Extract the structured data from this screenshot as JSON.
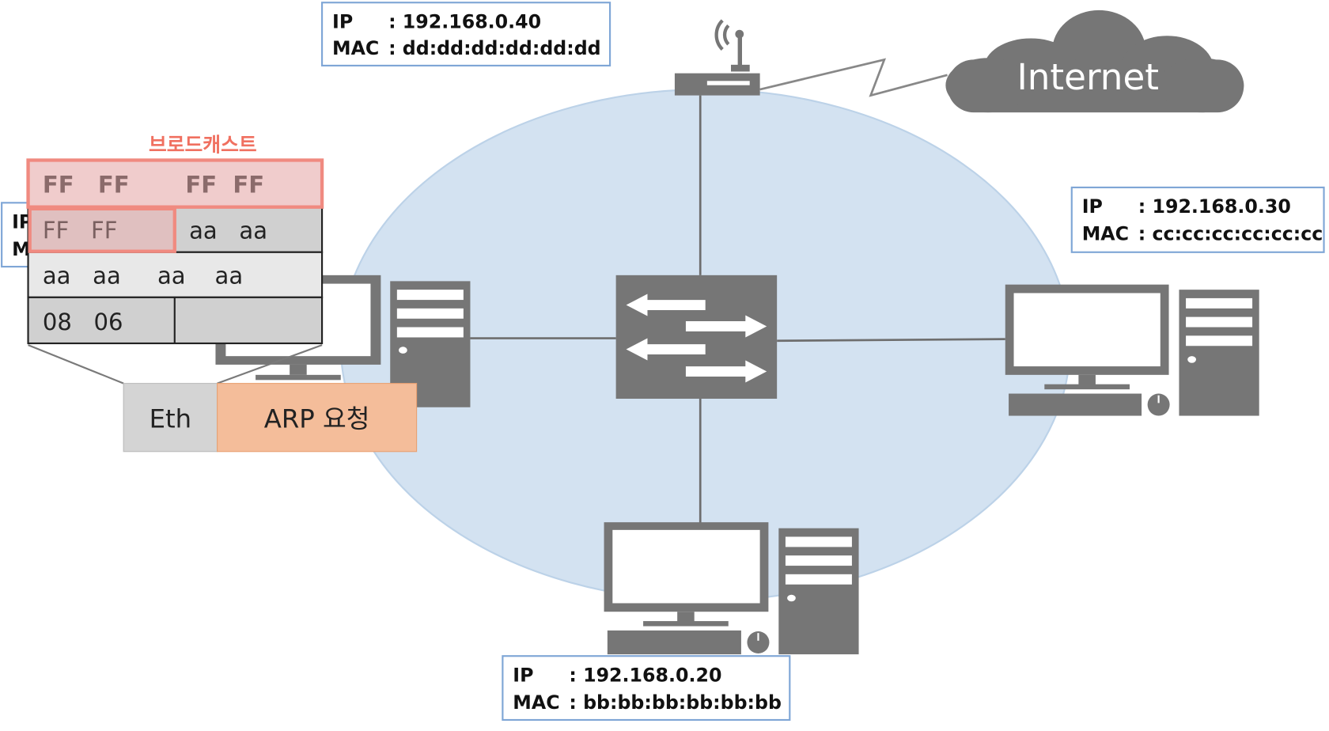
{
  "colors": {
    "lan": "#d3e2f1",
    "device": "#767676",
    "broadcast": "#f07a6a",
    "arp": "#f4bd9a",
    "eth": "#d4d4d4"
  },
  "router_info": {
    "ip_label": "IP",
    "ip": ": 192.168.0.40",
    "mac_label": "MAC",
    "mac": ": dd:dd:dd:dd:dd:dd"
  },
  "host_c_info": {
    "ip_label": "IP",
    "ip": ": 192.168.0.30",
    "mac_label": "MAC",
    "mac": ": cc:cc:cc:cc:cc:cc"
  },
  "host_b_info": {
    "ip_label": "IP",
    "ip": ": 192.168.0.20",
    "mac_label": "MAC",
    "mac": ": bb:bb:bb:bb:bb:bb"
  },
  "host_a_info": {
    "ip_label": "IP",
    "mac_label": "MAC"
  },
  "cloud": {
    "label": "Internet"
  },
  "frame": {
    "broadcast_label": "브로드캐스트",
    "row1": "FF   FF       FF  FF",
    "row2_left": "FF   FF",
    "row2_right": "aa   aa",
    "row3": "aa   aa     aa    aa",
    "row4_left": "08   06",
    "row4_right": ""
  },
  "packet": {
    "eth_label": "Eth",
    "arp_label": "ARP 요청"
  }
}
